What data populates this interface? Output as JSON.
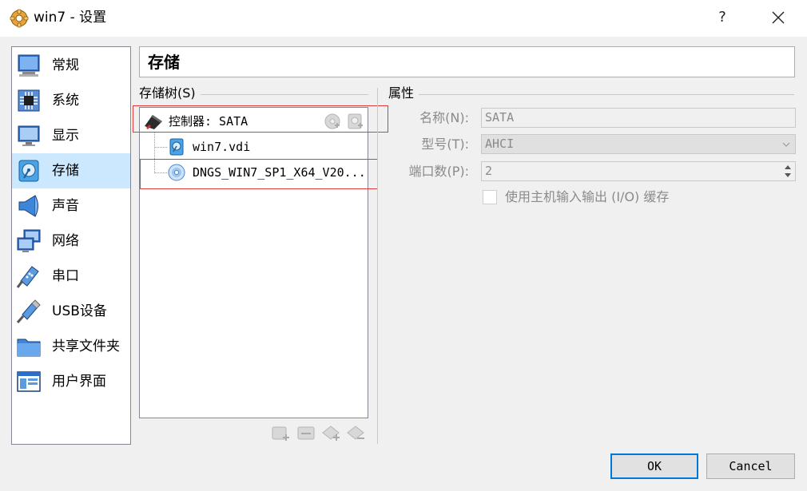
{
  "window": {
    "title": "win7 - 设置",
    "help": "?"
  },
  "sidebar": {
    "items": [
      {
        "label": "常规",
        "icon": "general-icon"
      },
      {
        "label": "系统",
        "icon": "chip-icon"
      },
      {
        "label": "显示",
        "icon": "monitor-icon"
      },
      {
        "label": "存储",
        "icon": "disk-icon",
        "selected": true
      },
      {
        "label": "声音",
        "icon": "speaker-icon"
      },
      {
        "label": "网络",
        "icon": "network-icon"
      },
      {
        "label": "串口",
        "icon": "serial-port-icon"
      },
      {
        "label": "USB设备",
        "icon": "usb-icon"
      },
      {
        "label": "共享文件夹",
        "icon": "folder-icon"
      },
      {
        "label": "用户界面",
        "icon": "ui-icon"
      }
    ]
  },
  "header": {
    "title": "存储"
  },
  "storage_tree": {
    "title": "存储树(S)",
    "controller": "控制器: SATA",
    "attachments": [
      "win7.vdi",
      "DNGS_WIN7_SP1_X64_V20..."
    ]
  },
  "attributes": {
    "title": "属性",
    "name_label": "名称(N):",
    "name_value": "SATA",
    "type_label": "型号(T):",
    "type_value": "AHCI",
    "ports_label": "端口数(P):",
    "ports_value": "2",
    "io_cache_label": "使用主机输入输出 (I/O) 缓存",
    "io_cache_checked": false
  },
  "buttons": {
    "ok": "OK",
    "cancel": "Cancel"
  },
  "colors": {
    "selection": "#cce8ff",
    "highlight_box": "#e03a3a",
    "accent": "#0078d7"
  }
}
